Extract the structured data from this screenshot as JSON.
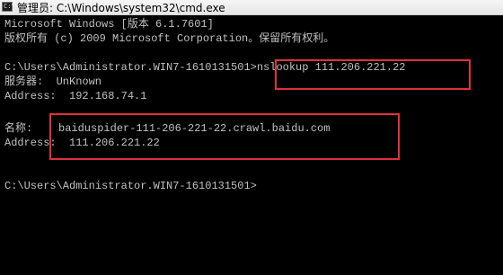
{
  "window": {
    "title": "管理员: C:\\Windows\\system32\\cmd.exe",
    "icon": "cmd-icon"
  },
  "console": {
    "lines": [
      "Microsoft Windows [版本 6.1.7601]",
      "版权所有 (c) 2009 Microsoft Corporation。保留所有权利。",
      "",
      "C:\\Users\\Administrator.WIN7-1610131501>nslookup 111.206.221.22",
      "服务器:  UnKnown",
      "Address:  192.168.74.1",
      "",
      "名称:    baiduspider-111-206-221-22.crawl.baidu.com",
      "Address:  111.206.221.22",
      "",
      "",
      "C:\\Users\\Administrator.WIN7-1610131501>"
    ]
  },
  "highlight_color": "#e0303a",
  "colors": {
    "console_bg": "#000000",
    "console_text": "#c0c0c0"
  }
}
